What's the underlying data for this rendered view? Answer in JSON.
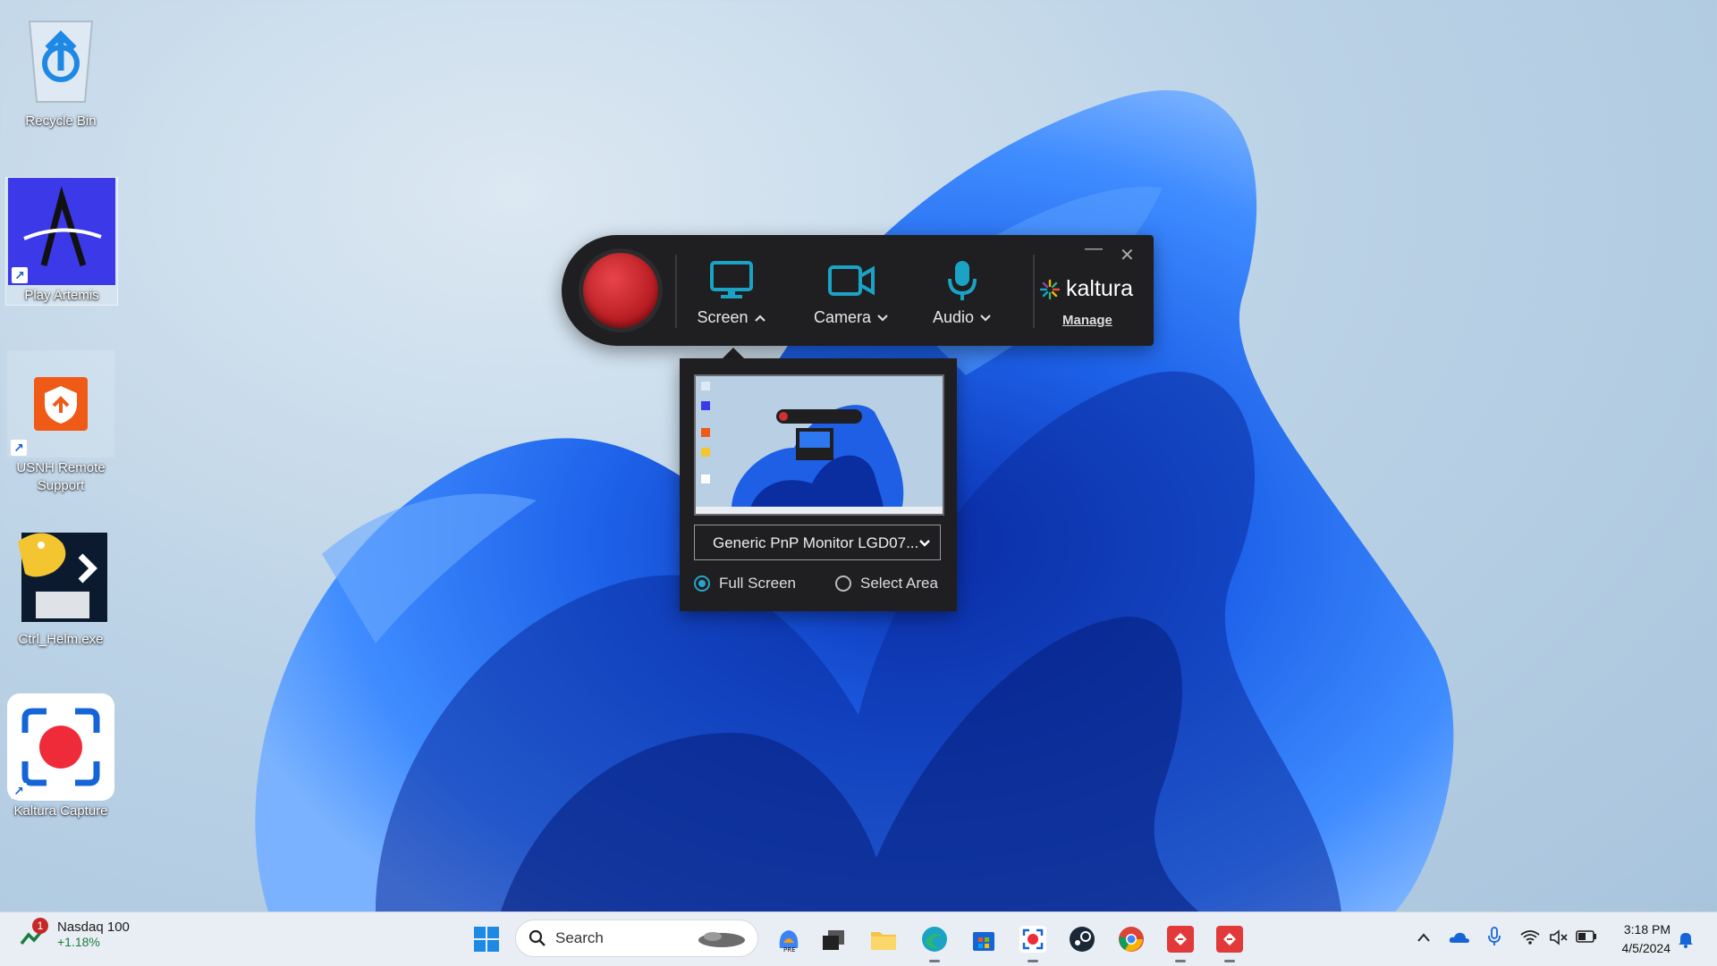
{
  "desktop": {
    "icons": [
      {
        "label": "Recycle Bin",
        "icon": "recycle-bin-icon"
      },
      {
        "label": "Play Artemis",
        "icon": "artemis-icon"
      },
      {
        "label": "USNH Remote Support",
        "icon": "remote-support-icon"
      },
      {
        "label": "Ctrl_Helm.exe",
        "icon": "python-helm-icon"
      },
      {
        "label": "Kaltura Capture",
        "icon": "kaltura-capture-icon"
      }
    ]
  },
  "recorder": {
    "record_icon": "record-button",
    "tools": [
      {
        "label": "Screen",
        "icon": "monitor-icon",
        "chevron": "^"
      },
      {
        "label": "Camera",
        "icon": "camera-icon",
        "chevron": "v"
      },
      {
        "label": "Audio",
        "icon": "microphone-icon",
        "chevron": "v"
      }
    ],
    "brand": "kaltura",
    "manage_label": "Manage",
    "accent_color": "#1aa3c4",
    "record_color": "#d32f2f"
  },
  "screen_panel": {
    "monitor_selected": "Generic PnP Monitor LGD07...",
    "options": [
      {
        "label": "Full Screen",
        "selected": true
      },
      {
        "label": "Select Area",
        "selected": false
      }
    ]
  },
  "taskbar": {
    "widget": {
      "name": "Nasdaq 100",
      "change": "+1.18%",
      "badge": "1"
    },
    "search_placeholder": "Search",
    "apps": [
      "start-icon",
      "copilot-icon",
      "task-view-icon",
      "file-explorer-icon",
      "edge-icon",
      "store-icon",
      "kaltura-icon",
      "steam-icon",
      "chrome-icon",
      "app-red-1-icon",
      "app-red-2-icon"
    ],
    "tray": [
      "chevron-up-icon",
      "onedrive-icon",
      "microphone-icon",
      "wifi-icon",
      "mute-icon",
      "battery-icon",
      "bell-icon"
    ],
    "time": "3:18 PM",
    "date": "4/5/2024"
  }
}
